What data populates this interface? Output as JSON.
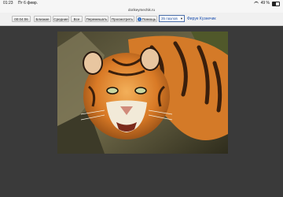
{
  "statusbar": {
    "time": "01:23",
    "date": "Пт 6 февр.",
    "battery": "49 %"
  },
  "browser": {
    "url": "dorikeymechik.ru"
  },
  "toolbar": {
    "items": [
      {
        "label": "00:04:06"
      },
      {
        "label": "Близкие"
      },
      {
        "label": "Средние"
      },
      {
        "label": "Все"
      },
      {
        "label": "Перемешать"
      },
      {
        "label": "Просмотреть"
      },
      {
        "label": "Помощь"
      }
    ],
    "select_value": "35 пазлов",
    "user_link": "Фируе Кузнечик"
  },
  "photo": {
    "subject": "tiger-photo"
  }
}
